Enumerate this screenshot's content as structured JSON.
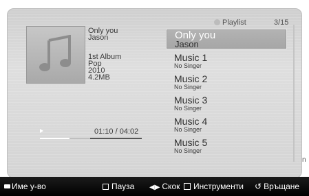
{
  "now_playing": {
    "title": "Only you",
    "artist": "Jason",
    "album": "1st Album",
    "genre": "Pop",
    "year": "2010",
    "size": "4.2MB",
    "time": "01:10 / 04:02",
    "progress": 0.29
  },
  "playlist": {
    "header": "Playlist",
    "count": "3/15",
    "items": [
      {
        "title": "Only you",
        "sub": "Jason"
      },
      {
        "title": "Music 1",
        "sub": "No Singer"
      },
      {
        "title": "Music 2",
        "sub": "No Singer"
      },
      {
        "title": "Music 3",
        "sub": "No Singer"
      },
      {
        "title": "Music 4",
        "sub": "No Singer"
      },
      {
        "title": "Music 5",
        "sub": "No Singer"
      }
    ]
  },
  "bottom_bar": {
    "device": "Име у-во",
    "pause": "Пауза",
    "skip": "Скок",
    "tools": "Инструменти",
    "return": "Връщане"
  },
  "side_mark": "n"
}
